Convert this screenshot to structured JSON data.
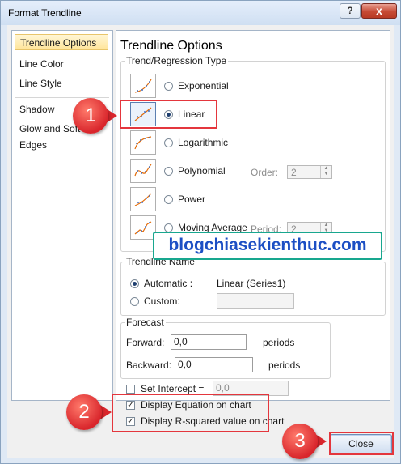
{
  "window": {
    "title": "Format Trendline",
    "help_label": "?",
    "close_label": "x"
  },
  "nav": {
    "items": [
      "Trendline Options",
      "Line Color",
      "Line Style",
      "Shadow",
      "Glow and Soft Edges"
    ],
    "selected": "Trendline Options"
  },
  "pane": {
    "title": "Trendline Options",
    "type_group": {
      "label": "Trend/Regression Type",
      "options": [
        {
          "label": "Exponential",
          "selected": false
        },
        {
          "label": "Linear",
          "selected": true
        },
        {
          "label": "Logarithmic",
          "selected": false
        },
        {
          "label": "Polynomial",
          "selected": false,
          "extra_label": "Order:",
          "extra_value": "2"
        },
        {
          "label": "Power",
          "selected": false
        },
        {
          "label": "Moving Average",
          "selected": false,
          "extra_label": "Period:",
          "extra_value": "2"
        }
      ]
    },
    "name_group": {
      "label": "Trendline Name",
      "automatic_label": "Automatic :",
      "automatic_value": "Linear (Series1)",
      "custom_label": "Custom:",
      "selected": "automatic"
    },
    "forecast_group": {
      "label": "Forecast",
      "forward_label": "Forward:",
      "forward_value": "0,0",
      "forward_unit": "periods",
      "backward_label": "Backward:",
      "backward_value": "0,0",
      "backward_unit": "periods"
    },
    "intercept": {
      "label": "Set Intercept =",
      "value": "0,0",
      "checked": false
    },
    "display_equation": {
      "label": "Display Equation on chart",
      "checked": true
    },
    "display_rsquared": {
      "label": "Display R-squared value on chart",
      "checked": true
    }
  },
  "buttons": {
    "close": "Close"
  },
  "watermark": "blogchiasekienthuc.com",
  "annotations": {
    "step1": "1",
    "step2": "2",
    "step3": "3"
  },
  "colors": {
    "highlight": "#e4363d",
    "watermark_text": "#1c4fc4",
    "watermark_border": "#18a78f",
    "selection": "#ffe59a"
  }
}
